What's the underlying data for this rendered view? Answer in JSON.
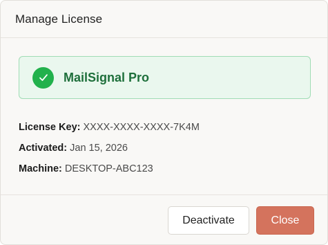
{
  "dialog": {
    "title": "Manage License"
  },
  "product": {
    "name": "MailSignal Pro",
    "status_icon": "check-circle-icon",
    "accent_color": "#22b14c"
  },
  "details": [
    {
      "label": "License Key:",
      "value": "XXXX-XXXX-XXXX-7K4M"
    },
    {
      "label": "Activated:",
      "value": "Jan 15, 2026"
    },
    {
      "label": "Machine:",
      "value": "DESKTOP-ABC123"
    }
  ],
  "footer": {
    "deactivate_label": "Deactivate",
    "close_label": "Close",
    "close_color": "#d4735d"
  }
}
